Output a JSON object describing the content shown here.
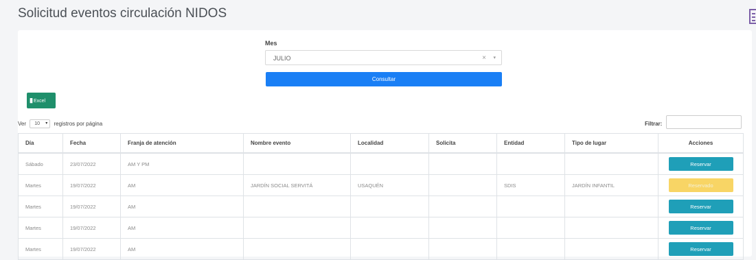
{
  "page": {
    "title": "Solicitud eventos circulación NIDOS"
  },
  "filters": {
    "mes_label": "Mes",
    "mes_value": "JULIO",
    "clear_glyph": "×",
    "caret_glyph": "▾",
    "consultar_label": "Consultar"
  },
  "toolbar": {
    "excel_label": "Excel",
    "excel_icon": "excel-icon"
  },
  "length": {
    "prefix": "Ver",
    "value": "10",
    "caret": "▾",
    "suffix": "registros por página"
  },
  "search": {
    "label": "Filtrar:",
    "value": ""
  },
  "table": {
    "headers": [
      "Día",
      "Fecha",
      "Franja de atención",
      "Nombre evento",
      "Localidad",
      "Solicita",
      "Entidad",
      "Tipo de lugar",
      "Acciones"
    ],
    "rows": [
      {
        "dia": "Sábado",
        "fecha": "23/07/2022",
        "franja": "AM Y PM",
        "nombre": "",
        "localidad": "",
        "solicita": "",
        "entidad": "",
        "tipo": "",
        "accion": "Reservar"
      },
      {
        "dia": "Martes",
        "fecha": "19/07/2022",
        "franja": "AM",
        "nombre": "JARDÍN SOCIAL SERVITÁ",
        "localidad": "USAQUÉN",
        "solicita": "",
        "entidad": "SDIS",
        "tipo": "JARDÍN INFANTIL",
        "accion": "Reservado"
      },
      {
        "dia": "Martes",
        "fecha": "19/07/2022",
        "franja": "AM",
        "nombre": "",
        "localidad": "",
        "solicita": "",
        "entidad": "",
        "tipo": "",
        "accion": "Reservar"
      },
      {
        "dia": "Martes",
        "fecha": "19/07/2022",
        "franja": "AM",
        "nombre": "",
        "localidad": "",
        "solicita": "",
        "entidad": "",
        "tipo": "",
        "accion": "Reservar"
      },
      {
        "dia": "Martes",
        "fecha": "19/07/2022",
        "franja": "AM",
        "nombre": "",
        "localidad": "",
        "solicita": "",
        "entidad": "",
        "tipo": "",
        "accion": "Reservar"
      }
    ]
  },
  "colors": {
    "primary": "#1a7ff5",
    "excel": "#1f8f6b",
    "reserve": "#1f9fb8",
    "reserved": "#f8d565"
  }
}
